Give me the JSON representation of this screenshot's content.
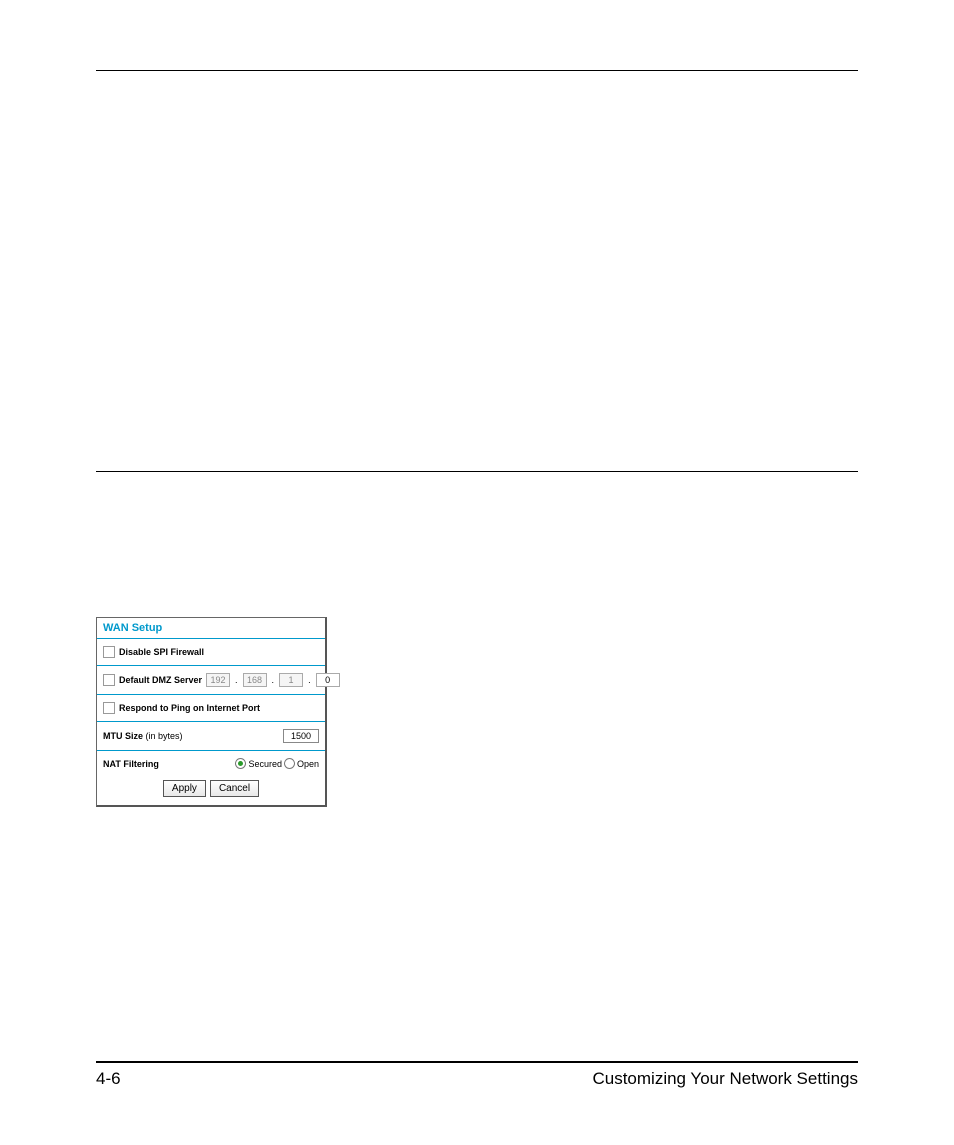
{
  "footer": {
    "page_number": "4-6",
    "section_title": "Customizing Your Network Settings"
  },
  "wan": {
    "title": "WAN Setup",
    "disable_spi": {
      "label": "Disable SPI Firewall",
      "checked": false
    },
    "dmz": {
      "label": "Default DMZ Server",
      "checked": false,
      "octets": [
        "192",
        "168",
        "1",
        "0"
      ]
    },
    "respond_ping": {
      "label": "Respond to Ping on Internet Port",
      "checked": false
    },
    "mtu": {
      "label": "MTU Size",
      "unit": "(in bytes)",
      "value": "1500"
    },
    "nat": {
      "label": "NAT Filtering",
      "options": {
        "secured": "Secured",
        "open": "Open"
      },
      "selected": "secured"
    },
    "buttons": {
      "apply": "Apply",
      "cancel": "Cancel"
    }
  }
}
